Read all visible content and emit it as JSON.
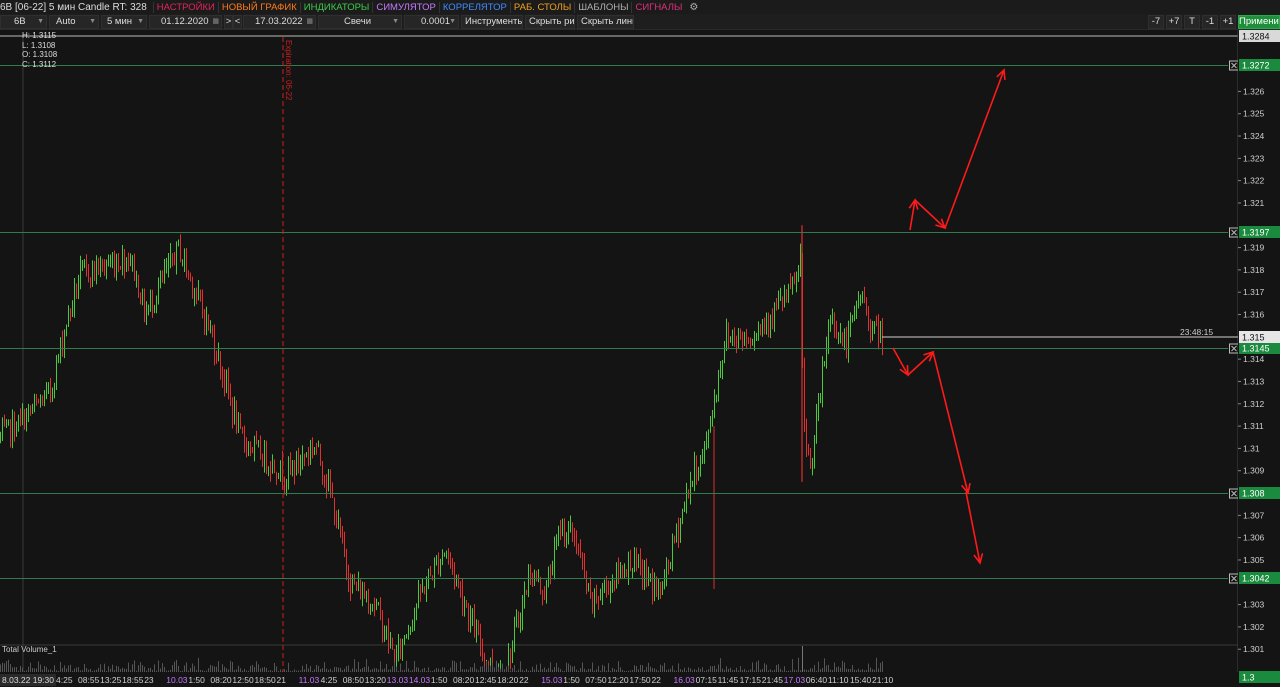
{
  "app": {
    "title": "6B [06-22] 5 мин Candle RT: 328",
    "menu": [
      {
        "label": "НАСТРОЙКИ",
        "color": "#e0245e"
      },
      {
        "label": "НОВЫЙ ГРАФИК",
        "color": "#ff7a1a"
      },
      {
        "label": "ИНДИКАТОРЫ",
        "color": "#3ec94a"
      },
      {
        "label": "СИМУЛЯТОР",
        "color": "#c779ff"
      },
      {
        "label": "КОРРЕЛЯТОР",
        "color": "#3f8cff"
      },
      {
        "label": "РАБ. СТОЛЫ",
        "color": "#f0a020"
      },
      {
        "label": "ШАБЛОНЫ",
        "color": "#b0b0b0"
      },
      {
        "label": "СИГНАЛЫ",
        "color": "#e0307a"
      }
    ],
    "gear_icon": "gear-icon"
  },
  "toolbar": {
    "symbol": "6B",
    "scale": "Auto",
    "timeframe": "5 мин",
    "date_from": "01.12.2020",
    "nav_next": ">",
    "nav_prev": "<",
    "date_to": "17.03.2022",
    "chart_type": "Свечи",
    "tick": "0.0001",
    "tools": "Инструменты",
    "hide_drawings": "Скрыть рис.",
    "hide_lines": "Скрыть линии",
    "zoom_buttons": [
      "-7",
      "+7",
      "T",
      "-1",
      "+1"
    ],
    "apply": "Применить"
  },
  "ohlc": {
    "h": "H: 1.3115",
    "l": "L: 1.3108",
    "o": "O: 1.3108",
    "c": "C: 1.3112"
  },
  "expiration_label": "Expiration: 06-22",
  "volume_label": "Total Volume_1",
  "corner_date": "8.03.22 19:30",
  "clock": "23:48:15",
  "price_axis": {
    "top_label": "1.3284",
    "ticks": [
      "1.326",
      "1.325",
      "1.324",
      "1.323",
      "1.322",
      "1.321",
      "1.319",
      "1.318",
      "1.317",
      "1.316",
      "1.314",
      "1.313",
      "1.312",
      "1.311",
      "1.31",
      "1.309",
      "1.307",
      "1.306",
      "1.305",
      "1.303",
      "1.302",
      "1.301"
    ],
    "current": "1.315",
    "bottom": "1.3"
  },
  "levels": [
    "1.3272",
    "1.3197",
    "1.3145",
    "1.308",
    "1.3042"
  ],
  "time_axis": [
    "4:25",
    "08:55",
    "13:25",
    "18:55",
    "23",
    "10.03",
    "1:50",
    "08:20",
    "12:50",
    "18:50",
    "21",
    "11.03",
    "4:25",
    "08:50",
    "13:20",
    "13.03",
    "14.03",
    "1:50",
    "08:20",
    "12:45",
    "18:20",
    "22",
    "15.03",
    "1:50",
    "07:50",
    "12:20",
    "17:50",
    "22",
    "16.03",
    "07:15",
    "11:45",
    "17:15",
    "21:45",
    "17.03",
    "06:40",
    "11:10",
    "15:40",
    "21:10"
  ],
  "colors": {
    "up": "#4cc93a",
    "down": "#e03030",
    "level_line": "#2f7d4c",
    "level_badge": "#1a8a3e",
    "arrow": "#ff1a1a",
    "expiration": "#c8201e"
  }
}
